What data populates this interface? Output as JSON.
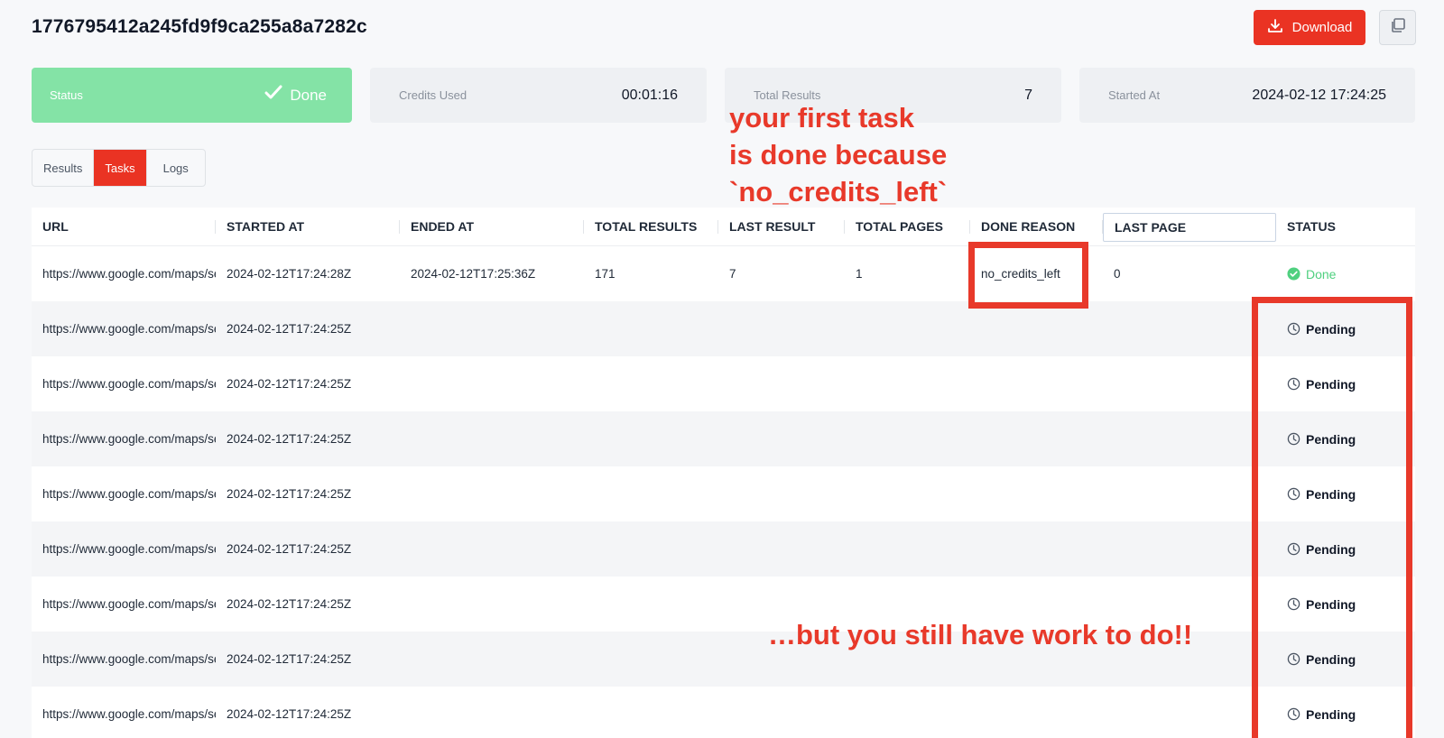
{
  "header": {
    "title": "1776795412a245fd9f9ca255a8a7282c",
    "download_label": "Download"
  },
  "cards": {
    "status": {
      "label": "Status",
      "value": "Done"
    },
    "credits": {
      "label": "Credits Used",
      "value": "00:01:16"
    },
    "results": {
      "label": "Total Results",
      "value": "7"
    },
    "started": {
      "label": "Started At",
      "value": "2024-02-12 17:24:25"
    }
  },
  "tabs": [
    {
      "label": "Results",
      "active": false
    },
    {
      "label": "Tasks",
      "active": true
    },
    {
      "label": "Logs",
      "active": false
    }
  ],
  "table": {
    "columns": [
      "URL",
      "STARTED AT",
      "ENDED AT",
      "TOTAL RESULTS",
      "LAST RESULT",
      "TOTAL PAGES",
      "DONE REASON",
      "LAST PAGE",
      "STATUS"
    ],
    "rows": [
      {
        "url": "https://www.google.com/maps/search/",
        "started_at": "2024-02-12T17:24:28Z",
        "ended_at": "2024-02-12T17:25:36Z",
        "total_results": "171",
        "last_result": "7",
        "total_pages": "1",
        "done_reason": "no_credits_left",
        "last_page": "0",
        "status": "Done"
      },
      {
        "url": "https://www.google.com/maps/search/",
        "started_at": "2024-02-12T17:24:25Z",
        "ended_at": "",
        "total_results": "",
        "last_result": "",
        "total_pages": "",
        "done_reason": "",
        "last_page": "",
        "status": "Pending"
      },
      {
        "url": "https://www.google.com/maps/search/",
        "started_at": "2024-02-12T17:24:25Z",
        "ended_at": "",
        "total_results": "",
        "last_result": "",
        "total_pages": "",
        "done_reason": "",
        "last_page": "",
        "status": "Pending"
      },
      {
        "url": "https://www.google.com/maps/search/",
        "started_at": "2024-02-12T17:24:25Z",
        "ended_at": "",
        "total_results": "",
        "last_result": "",
        "total_pages": "",
        "done_reason": "",
        "last_page": "",
        "status": "Pending"
      },
      {
        "url": "https://www.google.com/maps/search/",
        "started_at": "2024-02-12T17:24:25Z",
        "ended_at": "",
        "total_results": "",
        "last_result": "",
        "total_pages": "",
        "done_reason": "",
        "last_page": "",
        "status": "Pending"
      },
      {
        "url": "https://www.google.com/maps/search/",
        "started_at": "2024-02-12T17:24:25Z",
        "ended_at": "",
        "total_results": "",
        "last_result": "",
        "total_pages": "",
        "done_reason": "",
        "last_page": "",
        "status": "Pending"
      },
      {
        "url": "https://www.google.com/maps/search/",
        "started_at": "2024-02-12T17:24:25Z",
        "ended_at": "",
        "total_results": "",
        "last_result": "",
        "total_pages": "",
        "done_reason": "",
        "last_page": "",
        "status": "Pending"
      },
      {
        "url": "https://www.google.com/maps/search/",
        "started_at": "2024-02-12T17:24:25Z",
        "ended_at": "",
        "total_results": "",
        "last_result": "",
        "total_pages": "",
        "done_reason": "",
        "last_page": "",
        "status": "Pending"
      },
      {
        "url": "https://www.google.com/maps/search/",
        "started_at": "2024-02-12T17:24:25Z",
        "ended_at": "",
        "total_results": "",
        "last_result": "",
        "total_pages": "",
        "done_reason": "",
        "last_page": "",
        "status": "Pending"
      }
    ]
  },
  "annotations": {
    "top_lines": [
      "your first task",
      "is done because",
      "`no_credits_left`"
    ],
    "bottom": "…but you still have work to do!!"
  },
  "colors": {
    "accent": "#ea3323",
    "status_done_bg": "#84e3a6",
    "done_text": "#4fd07f",
    "annotation": "#e8392a"
  },
  "icons": {
    "download": "download-icon",
    "copy": "copy-icon",
    "check": "check-icon",
    "check_circle": "check-circle-icon",
    "clock": "clock-icon"
  }
}
